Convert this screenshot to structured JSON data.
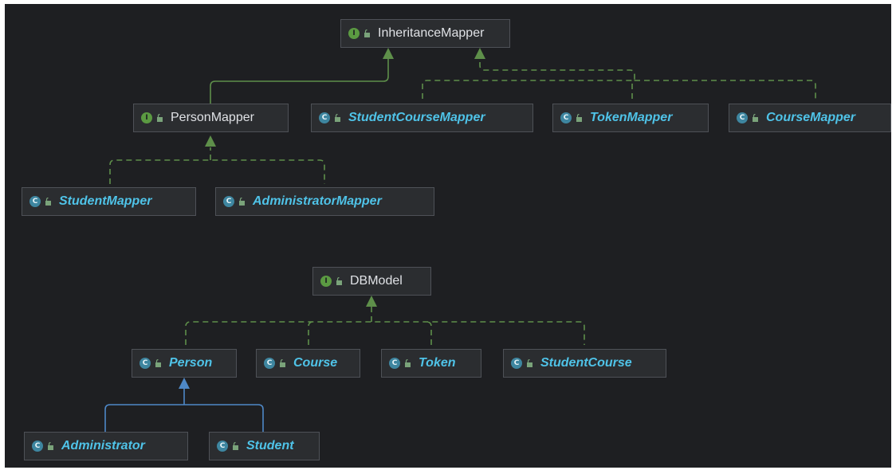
{
  "colors": {
    "background": "#1e1f22",
    "node_fill": "#2b2d30",
    "node_border": "#4e5157",
    "interface_badge": "#5b9a42",
    "class_badge": "#3e86a0",
    "class_label": "#4fc3e8",
    "interface_label": "#dfe1e5",
    "implements_edge": "#5e8f4a",
    "extends_interface_edge": "#5e8f4a",
    "extends_class_edge": "#4e88c7"
  },
  "badges": {
    "interface": "I",
    "class": "C"
  },
  "nodes": {
    "inheritance_mapper": "InheritanceMapper",
    "person_mapper": "PersonMapper",
    "student_course_mapper": "StudentCourseMapper",
    "token_mapper": "TokenMapper",
    "course_mapper": "CourseMapper",
    "student_mapper": "StudentMapper",
    "administrator_mapper": "AdministratorMapper",
    "db_model": "DBModel",
    "person": "Person",
    "course": "Course",
    "token": "Token",
    "student_course": "StudentCourse",
    "administrator": "Administrator",
    "student": "Student"
  },
  "edges": [
    {
      "from": "person_mapper",
      "to": "inheritance_mapper",
      "kind": "extends-interface",
      "style": "solid"
    },
    {
      "from": "student_course_mapper",
      "to": "inheritance_mapper",
      "kind": "implements",
      "style": "dashed"
    },
    {
      "from": "token_mapper",
      "to": "inheritance_mapper",
      "kind": "implements",
      "style": "dashed"
    },
    {
      "from": "course_mapper",
      "to": "inheritance_mapper",
      "kind": "implements",
      "style": "dashed"
    },
    {
      "from": "student_mapper",
      "to": "person_mapper",
      "kind": "implements",
      "style": "dashed"
    },
    {
      "from": "administrator_mapper",
      "to": "person_mapper",
      "kind": "implements",
      "style": "dashed"
    },
    {
      "from": "person",
      "to": "db_model",
      "kind": "implements",
      "style": "dashed"
    },
    {
      "from": "course",
      "to": "db_model",
      "kind": "implements",
      "style": "dashed"
    },
    {
      "from": "token",
      "to": "db_model",
      "kind": "implements",
      "style": "dashed"
    },
    {
      "from": "student_course",
      "to": "db_model",
      "kind": "implements",
      "style": "dashed"
    },
    {
      "from": "administrator",
      "to": "person",
      "kind": "extends-class",
      "style": "solid"
    },
    {
      "from": "student",
      "to": "person",
      "kind": "extends-class",
      "style": "solid"
    }
  ]
}
